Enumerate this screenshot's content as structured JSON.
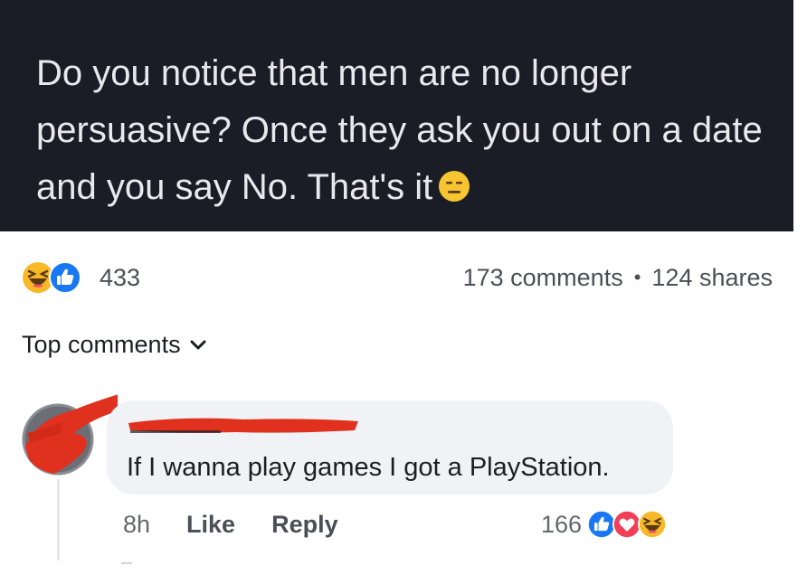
{
  "post": {
    "text": "Do you notice that men are no longer persuasive? Once they ask you out on a date and you say No. That's it",
    "trailing_emoji": "expressionless-face-emoji"
  },
  "reactions": {
    "icons": [
      "haha-reaction-icon",
      "like-reaction-icon"
    ],
    "count": "433",
    "comments": "173 comments",
    "separator": "•",
    "shares": "124 shares"
  },
  "filter": {
    "label": "Top comments",
    "icon": "chevron-down-icon"
  },
  "comment": {
    "author_redacted": true,
    "text": "If I wanna play games I got a PlayStation.",
    "time": "8h",
    "like_label": "Like",
    "reply_label": "Reply",
    "reaction_count": "166",
    "reaction_icons": [
      "like-reaction-icon",
      "love-reaction-icon",
      "haha-reaction-icon"
    ]
  },
  "colors": {
    "post_bg": "#1a1d26",
    "post_text": "#e8e9ee",
    "like_blue": "#1877f2",
    "love_red": "#f33e58",
    "haha_yellow": "#f7b928",
    "redaction_red": "#e0301e"
  }
}
